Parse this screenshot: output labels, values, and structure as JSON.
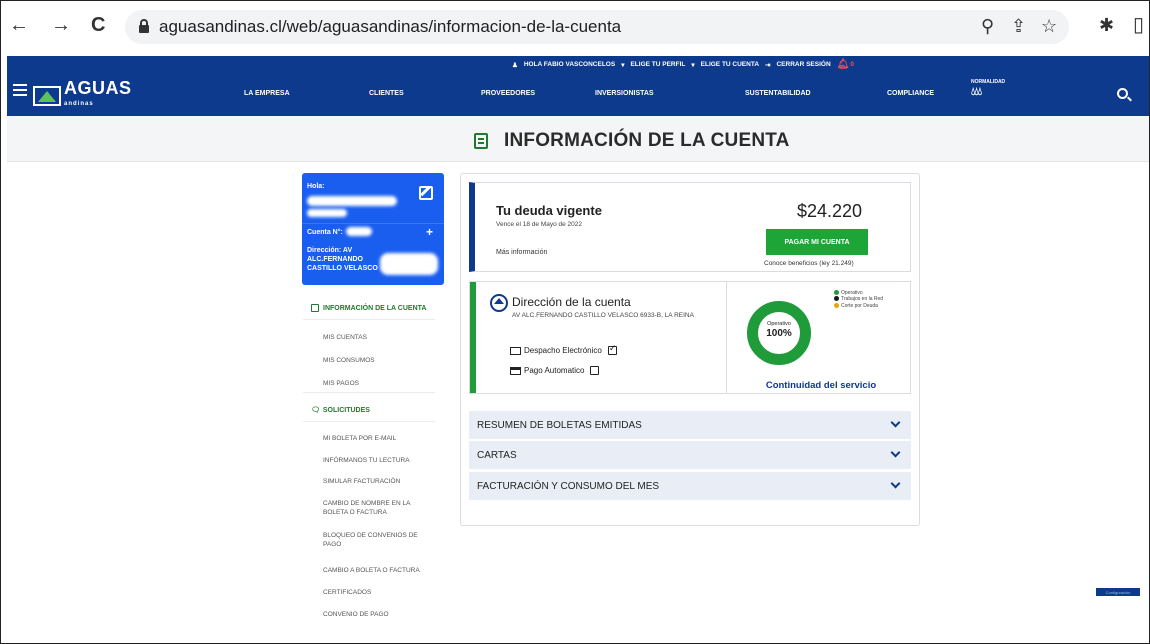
{
  "browser": {
    "back": "←",
    "forward": "→",
    "reload": "C",
    "url": "aguasandinas.cl/web/aguasandinas/informacion-de-la-cuenta",
    "icons": [
      "zoom-icon",
      "share-icon",
      "star-icon",
      "extensions-icon"
    ]
  },
  "header": {
    "user_greeting": "HOLA FABIO VASCONCELOS",
    "profile_menu": "ELIGE TU PERFIL",
    "account_menu": "ELIGE TU CUENTA",
    "logout": "CERRAR SESIÓN",
    "notifications": "0",
    "logo_text": "AGUAS",
    "logo_sub": "andinas",
    "nav": [
      "LA EMPRESA",
      "CLIENTES",
      "PROVEEDORES",
      "INVERSIONISTAS",
      "SUSTENTABILIDAD",
      "COMPLIANCE"
    ],
    "status_badge": "NORMALIDAD",
    "brand_color": "#0d3a8c"
  },
  "page": {
    "title": "INFORMACIÓN DE LA CUENTA"
  },
  "sidebar": {
    "greeting": "Hola:",
    "account_label": "Cuenta N°:",
    "address_label": "Dirección: AV ALC.FERNANDO CASTILLO VELASCO",
    "section_info": "INFORMACIÓN DE LA CUENTA",
    "info_items": [
      "MIS CUENTAS",
      "MIS CONSUMOS",
      "MIS PAGOS"
    ],
    "section_requests": "SOLICITUDES",
    "request_items": [
      "MI BOLETA POR E-MAIL",
      "INFÓRMANOS TU LECTURA",
      "SIMULAR FACTURACIÓN",
      "CAMBIO DE NOMBRE EN LA BOLETA O FACTURA",
      "BLOQUEO DE CONVENIOS DE PAGO",
      "CAMBIO A BOLETA O FACTURA",
      "CERTIFICADOS",
      "CONVENIO DE PAGO"
    ]
  },
  "debt": {
    "title": "Tu deuda vigente",
    "due": "Vence el 18 de Mayo de 2022",
    "more_info": "Más información",
    "amount": "$24.220",
    "pay_button": "PAGAR MI CUENTA",
    "benefits": "Conoce beneficios (ley 21.249)"
  },
  "address": {
    "title": "Dirección de la cuenta",
    "line": "AV ALC.FERNANDO CASTILLO VELASCO 6933-B, LA REINA",
    "electronic": "Despacho Electrónico",
    "electronic_checked": true,
    "auto_pay": "Pago Automatico",
    "auto_pay_checked": false
  },
  "service": {
    "legend": [
      {
        "label": "Operativo",
        "color": "#1f9b3a"
      },
      {
        "label": "Trabajos en la Red",
        "color": "#1a1a1a"
      },
      {
        "label": "Corte por Deuda",
        "color": "#e0a800"
      }
    ],
    "status_label": "Operativo",
    "status_value": "100%",
    "status_fraction": 1.0,
    "title": "Continuidad del servicio"
  },
  "accordion": [
    "RESUMEN DE BOLETAS EMITIDAS",
    "CARTAS",
    "FACTURACIÓN Y CONSUMO DEL MES"
  ],
  "cookie_label": "Configuración"
}
